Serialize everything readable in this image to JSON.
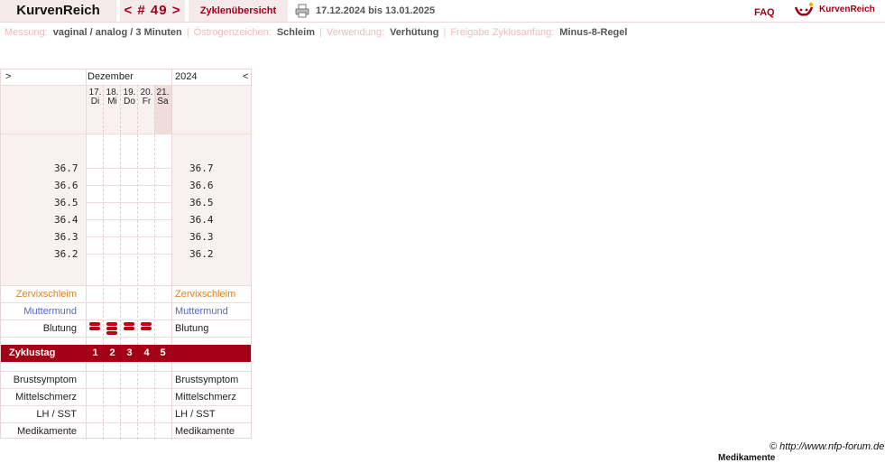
{
  "topbar": {
    "brand": "KurvenReich",
    "cycle_nav": "< # 49 >",
    "overview_tab": "Zyklenübersicht",
    "date_range": "17.12.2024 bis 13.01.2025",
    "faq": "FAQ",
    "logo_text": "KurvenReich"
  },
  "info": {
    "messung_label": "Messung:",
    "messung_value": "vaginal / analog / 3 Minuten",
    "oestrogen_label": "Östrogenzeichen:",
    "oestrogen_value": "Schleim",
    "verwendung_label": "Verwendung:",
    "verwendung_value": "Verhütung",
    "freigabe_label": "Freigabe Zyklusanfang:",
    "freigabe_value": "Minus-8-Regel"
  },
  "chart": {
    "nav_left": ">",
    "nav_right": "<",
    "month": "Dezember",
    "year": "2024",
    "days": [
      {
        "date": "17.",
        "weekday": "Di",
        "cycle_day": "1",
        "bleeding": 1
      },
      {
        "date": "18.",
        "weekday": "Mi",
        "cycle_day": "2",
        "bleeding": 2
      },
      {
        "date": "19.",
        "weekday": "Do",
        "cycle_day": "3",
        "bleeding": 1
      },
      {
        "date": "20.",
        "weekday": "Fr",
        "cycle_day": "4",
        "bleeding": 1
      },
      {
        "date": "21.",
        "weekday": "Sa",
        "cycle_day": "5",
        "bleeding": 0
      }
    ],
    "temperatures": [
      "36.7",
      "36.6",
      "36.5",
      "36.4",
      "36.3",
      "36.2"
    ],
    "rows": {
      "zervixschleim": "Zervixschleim",
      "muttermund": "Muttermund",
      "blutung": "Blutung",
      "zyklustag": "Zyklustag",
      "brustsymptom": "Brustsymptom",
      "mittelschmerz": "Mittelschmerz",
      "lh_sst": "LH / SST",
      "medikamente": "Medikamente"
    },
    "colors": {
      "zervix": "#e08020",
      "muttermund": "#5566cc",
      "accent": "#a30016"
    }
  },
  "footer": {
    "copyright": "© http://www.nfp-forum.de",
    "overflow_label": "Medikamente"
  }
}
